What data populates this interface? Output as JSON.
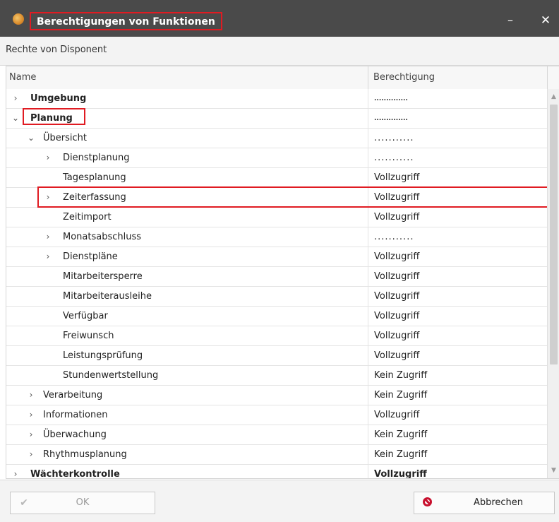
{
  "window": {
    "title": "Berechtigungen von Funktionen",
    "minimize_glyph": "–",
    "close_glyph": "✕"
  },
  "subheader": {
    "text": "Rechte von Disponent"
  },
  "grid": {
    "columns": {
      "name": "Name",
      "permission": "Berechtigung"
    },
    "rows": [
      {
        "name": "Umgebung",
        "permission": "..............",
        "expander": "›",
        "bold": true
      },
      {
        "name": "Planung",
        "permission": "..............",
        "expander": "⌄",
        "bold": true
      },
      {
        "name": "Übersicht",
        "permission": "...........",
        "expander": "⌄"
      },
      {
        "name": "Dienstplanung",
        "permission": "...........",
        "expander": "›"
      },
      {
        "name": "Tagesplanung",
        "permission": "Vollzugriff",
        "expander": ""
      },
      {
        "name": "Zeiterfassung",
        "permission": "Vollzugriff",
        "expander": "›"
      },
      {
        "name": "Zeitimport",
        "permission": "Vollzugriff",
        "expander": ""
      },
      {
        "name": "Monatsabschluss",
        "permission": "...........",
        "expander": "›"
      },
      {
        "name": "Dienstpläne",
        "permission": "Vollzugriff",
        "expander": "›"
      },
      {
        "name": "Mitarbeitersperre",
        "permission": "Vollzugriff",
        "expander": ""
      },
      {
        "name": "Mitarbeiterausleihe",
        "permission": "Vollzugriff",
        "expander": ""
      },
      {
        "name": "Verfügbar",
        "permission": "Vollzugriff",
        "expander": ""
      },
      {
        "name": "Freiwunsch",
        "permission": "Vollzugriff",
        "expander": ""
      },
      {
        "name": "Leistungsprüfung",
        "permission": "Vollzugriff",
        "expander": ""
      },
      {
        "name": "Stundenwertstellung",
        "permission": "Kein Zugriff",
        "expander": ""
      },
      {
        "name": "Verarbeitung",
        "permission": "Kein Zugriff",
        "expander": "›"
      },
      {
        "name": "Informationen",
        "permission": "Vollzugriff",
        "expander": "›"
      },
      {
        "name": "Überwachung",
        "permission": "Kein Zugriff",
        "expander": "›"
      },
      {
        "name": "Rhythmusplanung",
        "permission": "Kein Zugriff",
        "expander": "›"
      },
      {
        "name": "Wächterkontrolle",
        "permission": "Vollzugriff",
        "expander": "›",
        "bold": true
      }
    ]
  },
  "scrollbar": {
    "up_glyph": "▲",
    "down_glyph": "▼"
  },
  "footer": {
    "ok_label": "OK",
    "ok_icon_glyph": "✔",
    "cancel_label": "Abbrechen"
  },
  "colors": {
    "titlebar": "#4a4a4a",
    "highlight": "#e01b22",
    "cancel_icon": "#c8102e"
  },
  "icons": {
    "app": "app-logo-icon",
    "cancel": "no-entry-icon",
    "ok": "checkmark-icon"
  }
}
